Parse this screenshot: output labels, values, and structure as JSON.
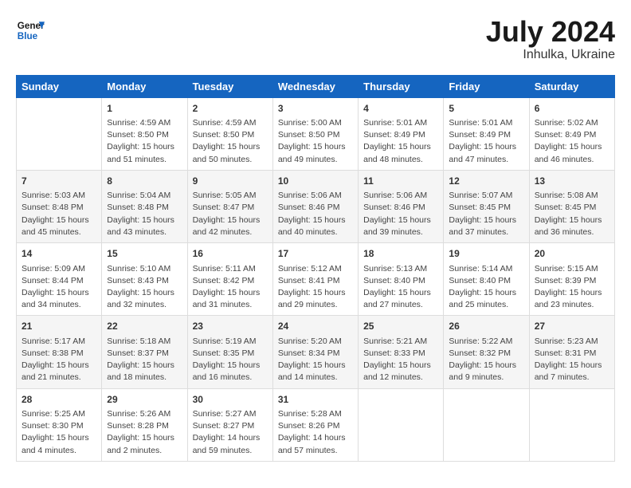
{
  "header": {
    "logo_line1": "General",
    "logo_line2": "Blue",
    "month_year": "July 2024",
    "location": "Inhulka, Ukraine"
  },
  "days_of_week": [
    "Sunday",
    "Monday",
    "Tuesday",
    "Wednesday",
    "Thursday",
    "Friday",
    "Saturday"
  ],
  "weeks": [
    [
      {
        "day": "",
        "content": ""
      },
      {
        "day": "1",
        "content": "Sunrise: 4:59 AM\nSunset: 8:50 PM\nDaylight: 15 hours\nand 51 minutes."
      },
      {
        "day": "2",
        "content": "Sunrise: 4:59 AM\nSunset: 8:50 PM\nDaylight: 15 hours\nand 50 minutes."
      },
      {
        "day": "3",
        "content": "Sunrise: 5:00 AM\nSunset: 8:50 PM\nDaylight: 15 hours\nand 49 minutes."
      },
      {
        "day": "4",
        "content": "Sunrise: 5:01 AM\nSunset: 8:49 PM\nDaylight: 15 hours\nand 48 minutes."
      },
      {
        "day": "5",
        "content": "Sunrise: 5:01 AM\nSunset: 8:49 PM\nDaylight: 15 hours\nand 47 minutes."
      },
      {
        "day": "6",
        "content": "Sunrise: 5:02 AM\nSunset: 8:49 PM\nDaylight: 15 hours\nand 46 minutes."
      }
    ],
    [
      {
        "day": "7",
        "content": "Sunrise: 5:03 AM\nSunset: 8:48 PM\nDaylight: 15 hours\nand 45 minutes."
      },
      {
        "day": "8",
        "content": "Sunrise: 5:04 AM\nSunset: 8:48 PM\nDaylight: 15 hours\nand 43 minutes."
      },
      {
        "day": "9",
        "content": "Sunrise: 5:05 AM\nSunset: 8:47 PM\nDaylight: 15 hours\nand 42 minutes."
      },
      {
        "day": "10",
        "content": "Sunrise: 5:06 AM\nSunset: 8:46 PM\nDaylight: 15 hours\nand 40 minutes."
      },
      {
        "day": "11",
        "content": "Sunrise: 5:06 AM\nSunset: 8:46 PM\nDaylight: 15 hours\nand 39 minutes."
      },
      {
        "day": "12",
        "content": "Sunrise: 5:07 AM\nSunset: 8:45 PM\nDaylight: 15 hours\nand 37 minutes."
      },
      {
        "day": "13",
        "content": "Sunrise: 5:08 AM\nSunset: 8:45 PM\nDaylight: 15 hours\nand 36 minutes."
      }
    ],
    [
      {
        "day": "14",
        "content": "Sunrise: 5:09 AM\nSunset: 8:44 PM\nDaylight: 15 hours\nand 34 minutes."
      },
      {
        "day": "15",
        "content": "Sunrise: 5:10 AM\nSunset: 8:43 PM\nDaylight: 15 hours\nand 32 minutes."
      },
      {
        "day": "16",
        "content": "Sunrise: 5:11 AM\nSunset: 8:42 PM\nDaylight: 15 hours\nand 31 minutes."
      },
      {
        "day": "17",
        "content": "Sunrise: 5:12 AM\nSunset: 8:41 PM\nDaylight: 15 hours\nand 29 minutes."
      },
      {
        "day": "18",
        "content": "Sunrise: 5:13 AM\nSunset: 8:40 PM\nDaylight: 15 hours\nand 27 minutes."
      },
      {
        "day": "19",
        "content": "Sunrise: 5:14 AM\nSunset: 8:40 PM\nDaylight: 15 hours\nand 25 minutes."
      },
      {
        "day": "20",
        "content": "Sunrise: 5:15 AM\nSunset: 8:39 PM\nDaylight: 15 hours\nand 23 minutes."
      }
    ],
    [
      {
        "day": "21",
        "content": "Sunrise: 5:17 AM\nSunset: 8:38 PM\nDaylight: 15 hours\nand 21 minutes."
      },
      {
        "day": "22",
        "content": "Sunrise: 5:18 AM\nSunset: 8:37 PM\nDaylight: 15 hours\nand 18 minutes."
      },
      {
        "day": "23",
        "content": "Sunrise: 5:19 AM\nSunset: 8:35 PM\nDaylight: 15 hours\nand 16 minutes."
      },
      {
        "day": "24",
        "content": "Sunrise: 5:20 AM\nSunset: 8:34 PM\nDaylight: 15 hours\nand 14 minutes."
      },
      {
        "day": "25",
        "content": "Sunrise: 5:21 AM\nSunset: 8:33 PM\nDaylight: 15 hours\nand 12 minutes."
      },
      {
        "day": "26",
        "content": "Sunrise: 5:22 AM\nSunset: 8:32 PM\nDaylight: 15 hours\nand 9 minutes."
      },
      {
        "day": "27",
        "content": "Sunrise: 5:23 AM\nSunset: 8:31 PM\nDaylight: 15 hours\nand 7 minutes."
      }
    ],
    [
      {
        "day": "28",
        "content": "Sunrise: 5:25 AM\nSunset: 8:30 PM\nDaylight: 15 hours\nand 4 minutes."
      },
      {
        "day": "29",
        "content": "Sunrise: 5:26 AM\nSunset: 8:28 PM\nDaylight: 15 hours\nand 2 minutes."
      },
      {
        "day": "30",
        "content": "Sunrise: 5:27 AM\nSunset: 8:27 PM\nDaylight: 14 hours\nand 59 minutes."
      },
      {
        "day": "31",
        "content": "Sunrise: 5:28 AM\nSunset: 8:26 PM\nDaylight: 14 hours\nand 57 minutes."
      },
      {
        "day": "",
        "content": ""
      },
      {
        "day": "",
        "content": ""
      },
      {
        "day": "",
        "content": ""
      }
    ]
  ]
}
